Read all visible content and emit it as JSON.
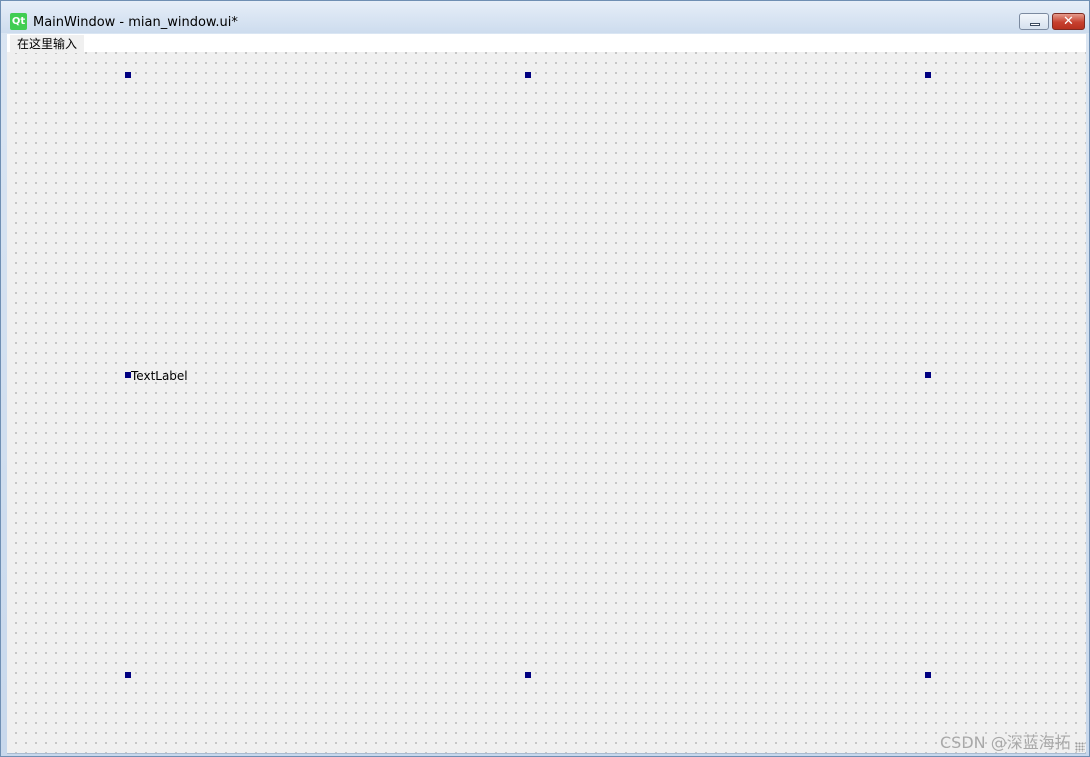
{
  "window": {
    "title": "MainWindow - mian_window.ui*",
    "app_icon_text": "Qt",
    "close_glyph": "✕"
  },
  "menubar": {
    "placeholder_item": "在这里输入"
  },
  "form": {
    "label_text": "TextLabel"
  },
  "watermark": {
    "text": "CSDN @深蓝海拓"
  },
  "colors": {
    "selection_handle": "#000080",
    "canvas_background": "#f0f0f0",
    "qt_green": "#41cd52"
  }
}
